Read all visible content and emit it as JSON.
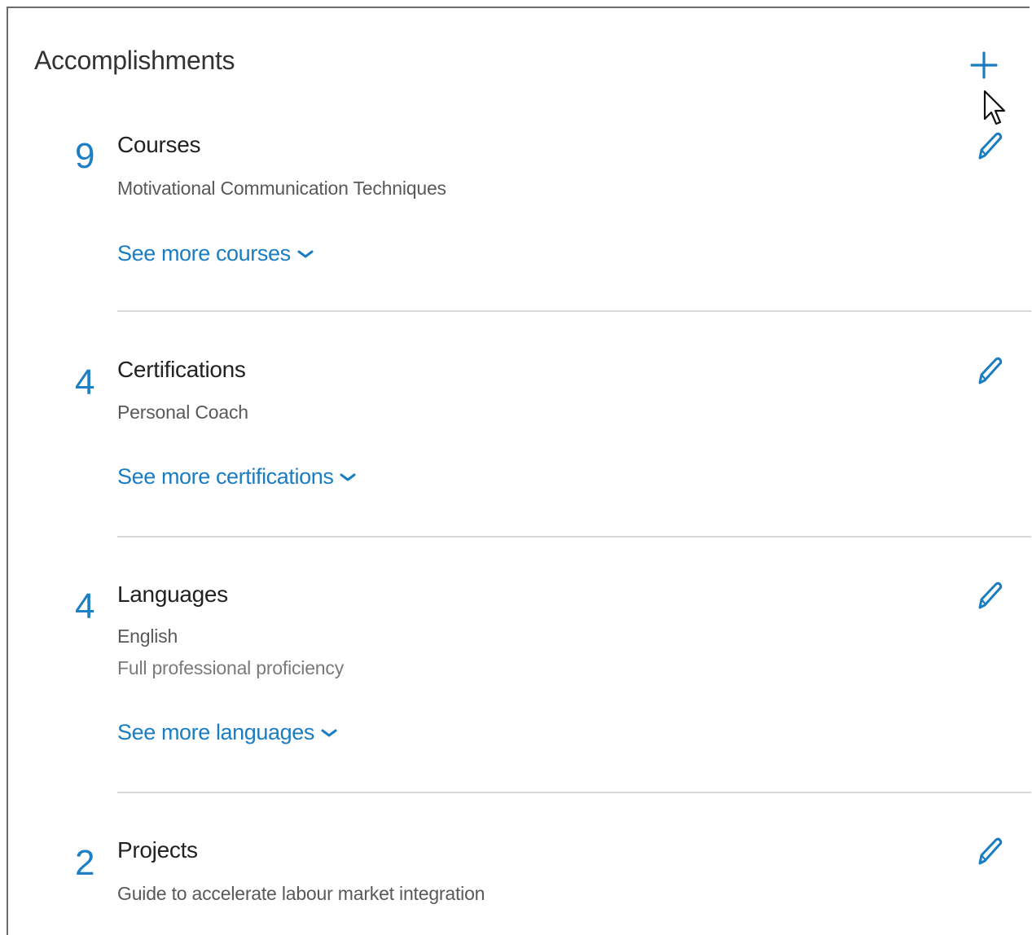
{
  "header": {
    "title": "Accomplishments",
    "add_icon": "plus-icon"
  },
  "sections": [
    {
      "count": "9",
      "heading": "Courses",
      "lines": [
        "Motivational Communication Techniques"
      ],
      "more_label": "See more courses",
      "edit_icon": "pencil-icon"
    },
    {
      "count": "4",
      "heading": "Certifications",
      "lines": [
        "Personal Coach"
      ],
      "more_label": "See more certifications",
      "edit_icon": "pencil-icon"
    },
    {
      "count": "4",
      "heading": "Languages",
      "lines": [
        "English",
        "Full professional proficiency"
      ],
      "more_label": "See more languages",
      "edit_icon": "pencil-icon"
    },
    {
      "count": "2",
      "heading": "Projects",
      "lines": [
        "Guide to accelerate labour market integration"
      ],
      "edit_icon": "pencil-icon"
    }
  ],
  "colors": {
    "accent": "#1a7dc2",
    "count": "#1d7fc4",
    "divider": "#d9d9d9"
  }
}
